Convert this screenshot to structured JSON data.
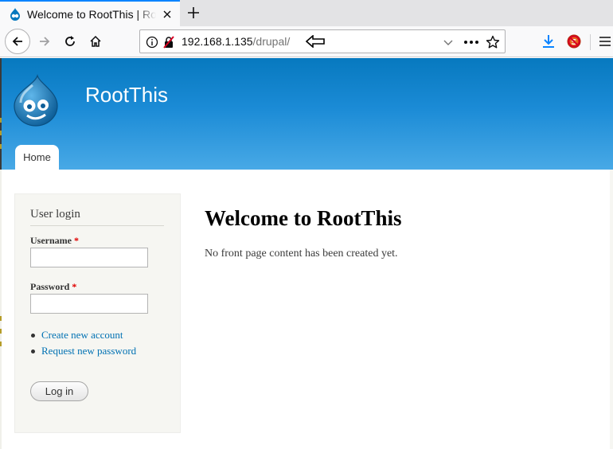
{
  "browser": {
    "tab_title": "Welcome to RootThis | RootThis",
    "url_host": "192.168.1.135",
    "url_path": "/drupal/",
    "icons": {
      "tab_favicon": "drupal-drop-icon",
      "tab_close": "close-icon",
      "new_tab": "plus-icon",
      "back": "back-arrow-icon",
      "forward": "forward-arrow-icon",
      "reload": "reload-icon",
      "home": "home-icon",
      "site_info": "info-icon",
      "insecure": "insecure-lock-icon",
      "cursor": "pointer-arrow-icon",
      "dropdown": "chevron-down-icon",
      "page_actions": "more-dots-icon",
      "bookmark": "star-icon",
      "downloads": "download-arrow-icon",
      "noscript": "noscript-icon",
      "menu": "hamburger-menu-icon"
    },
    "accent_color": "#0a84ff"
  },
  "site": {
    "name": "RootThis",
    "logo": "drupal-logo",
    "header_color": "#0779bf",
    "primary_tab": "Home"
  },
  "sidebar": {
    "block_title": "User login",
    "username_label": "Username",
    "password_label": "Password",
    "required_marker": "*",
    "username_value": "",
    "password_value": "",
    "links": [
      {
        "label": "Create new account"
      },
      {
        "label": "Request new password"
      }
    ],
    "login_button": "Log in",
    "link_color": "#0071b3"
  },
  "main": {
    "title": "Welcome to RootThis",
    "text": "No front page content has been created yet."
  }
}
